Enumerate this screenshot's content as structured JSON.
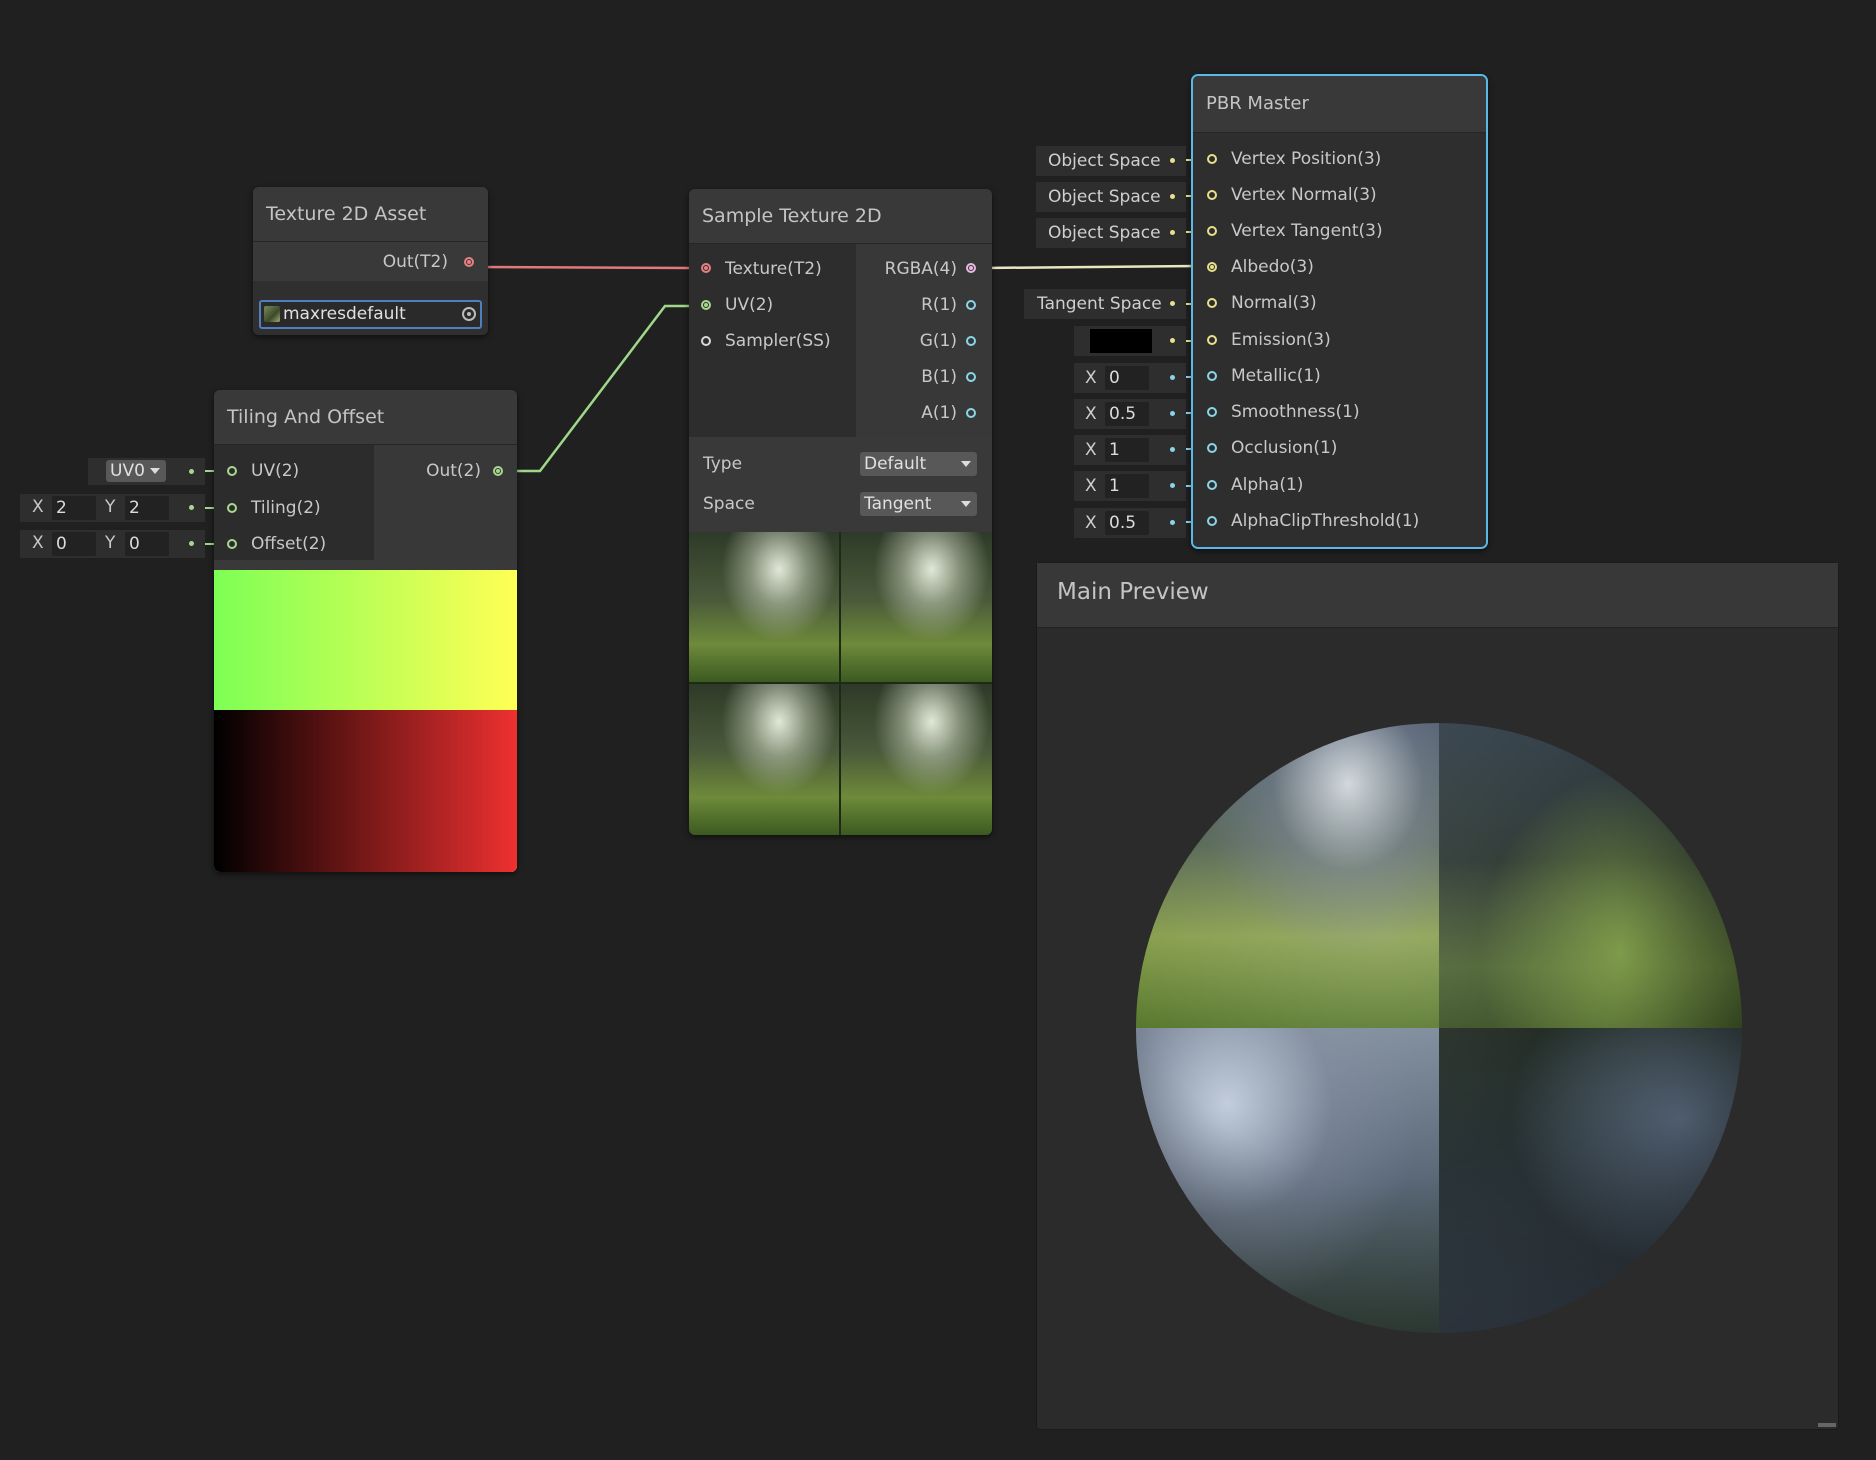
{
  "texture_asset_node": {
    "title": "Texture 2D Asset",
    "out_port": "Out(T2)",
    "object_field": "maxresdefault",
    "object_icon": "image-icon",
    "picker_icon": "object-picker-icon"
  },
  "tiling_node": {
    "title": "Tiling And Offset",
    "inputs": [
      "UV(2)",
      "Tiling(2)",
      "Offset(2)"
    ],
    "output": "Out(2)",
    "uv_channel": "UV0",
    "tiling": {
      "x_label": "X",
      "x": "2",
      "y_label": "Y",
      "y": "2"
    },
    "offset": {
      "x_label": "X",
      "x": "0",
      "y_label": "Y",
      "y": "0"
    },
    "preview_colors": {
      "top_left": "#7dff55",
      "top_right": "#ffff55",
      "bottom_left": "#000000",
      "bottom_right": "#ee3030"
    }
  },
  "sample_node": {
    "title": "Sample Texture 2D",
    "inputs": [
      "Texture(T2)",
      "UV(2)",
      "Sampler(SS)"
    ],
    "outputs": [
      "RGBA(4)",
      "R(1)",
      "G(1)",
      "B(1)",
      "A(1)"
    ],
    "props": [
      {
        "label": "Type",
        "value": "Default"
      },
      {
        "label": "Space",
        "value": "Tangent"
      }
    ]
  },
  "pbr_node": {
    "title": "PBR Master",
    "inputs": [
      "Vertex Position(3)",
      "Vertex Normal(3)",
      "Vertex Tangent(3)",
      "Albedo(3)",
      "Normal(3)",
      "Emission(3)",
      "Metallic(1)",
      "Smoothness(1)",
      "Occlusion(1)",
      "Alpha(1)",
      "AlphaClipThreshold(1)"
    ],
    "stubs": {
      "vertex_position": "Object Space",
      "vertex_normal": "Object Space",
      "vertex_tangent": "Object Space",
      "normal": "Tangent Space",
      "emission_color": "#000000",
      "metallic": {
        "label": "X",
        "value": "0"
      },
      "smoothness": {
        "label": "X",
        "value": "0.5"
      },
      "occlusion": {
        "label": "X",
        "value": "1"
      },
      "alpha": {
        "label": "X",
        "value": "1"
      },
      "alpha_clip": {
        "label": "X",
        "value": "0.5"
      }
    }
  },
  "main_preview": {
    "title": "Main Preview"
  },
  "colors": {
    "background": "#202020",
    "selection": "#5ab8e8",
    "edge_texture": "#e07a7a",
    "edge_uv": "#9fd88a",
    "edge_rgba": "#e8e8c0"
  }
}
